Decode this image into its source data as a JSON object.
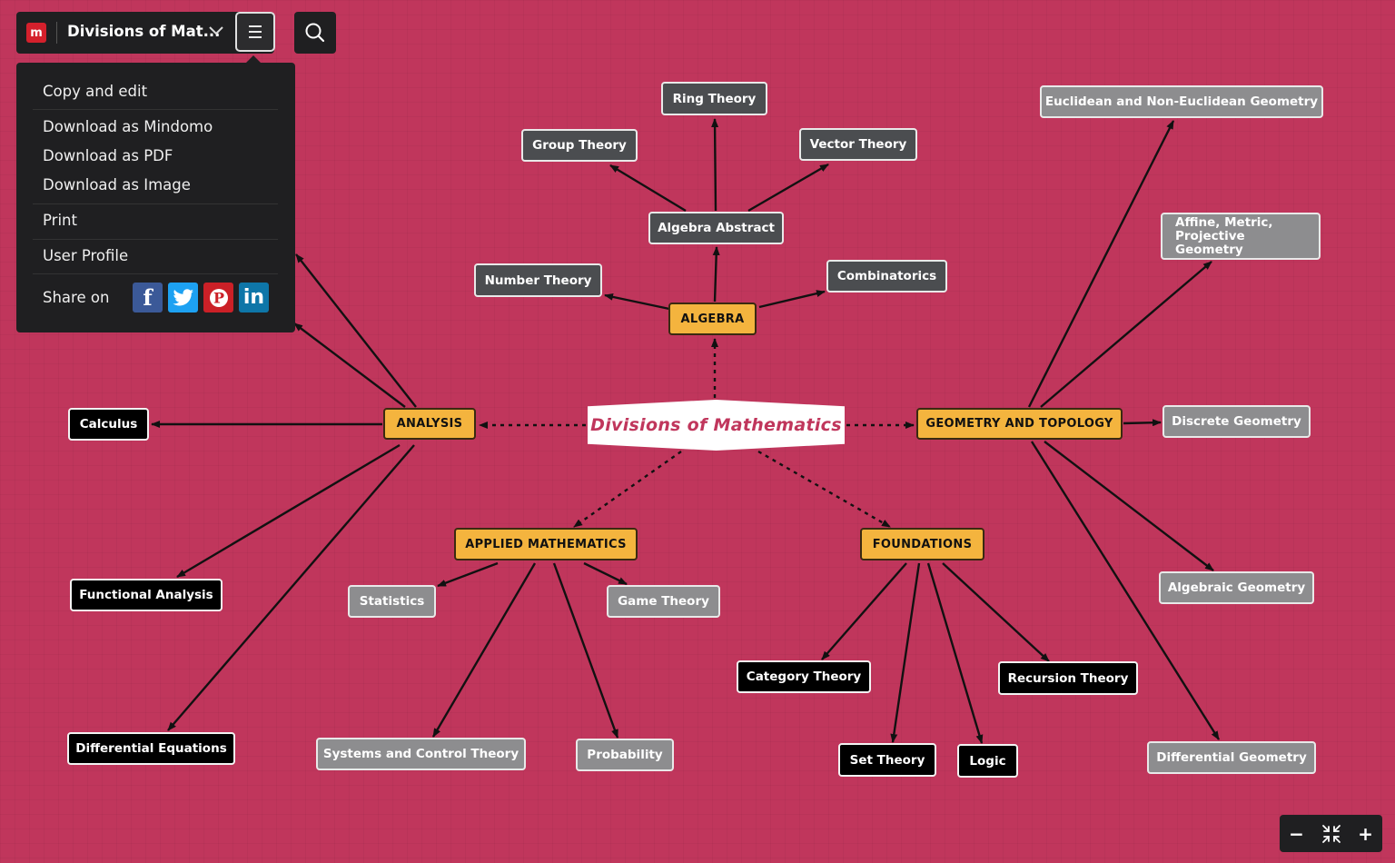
{
  "app": {
    "map_title": "Divisions of Mat...",
    "logo_text": "m"
  },
  "menu": {
    "items": [
      "Copy and edit",
      "Download as Mindomo",
      "Download as PDF",
      "Download as Image",
      "Print",
      "User Profile"
    ],
    "share_label": "Share on",
    "social": [
      {
        "name": "facebook",
        "glyph": "f",
        "color": "#3b5998"
      },
      {
        "name": "twitter",
        "glyph": "t",
        "color": "#1da1f2"
      },
      {
        "name": "pinterest",
        "glyph": "P",
        "color": "#cb2027"
      },
      {
        "name": "linkedin",
        "glyph": "in",
        "color": "#0e76a8"
      }
    ]
  },
  "mindmap": {
    "central": "Divisions of Mathematics",
    "branches": {
      "algebra": "ALGEBRA",
      "analysis": "ANALYSIS",
      "geometry": "GEOMETRY AND TOPOLOGY",
      "applied": "APPLIED MATHEMATICS",
      "foundations": "FOUNDATIONS"
    },
    "topics": {
      "ring_theory": "Ring Theory",
      "group_theory": "Group Theory",
      "vector_theory": "Vector Theory",
      "algebra_abstract": "Algebra Abstract",
      "number_theory": "Number Theory",
      "combinatorics": "Combinatorics",
      "calculus": "Calculus",
      "functional_analysis": "Functional Analysis",
      "differential_equations": "Differential Equations",
      "statistics": "Statistics",
      "game_theory": "Game Theory",
      "systems_control": "Systems and Control Theory",
      "probability": "Probability",
      "category_theory": "Category Theory",
      "recursion_theory": "Recursion Theory",
      "set_theory": "Set Theory",
      "logic": "Logic",
      "euclidean": "Euclidean and Non-Euclidean Geometry",
      "affine": "Affine, Metric, Projective Geometry",
      "discrete_geometry": "Discrete Geometry",
      "algebraic_geometry": "Algebraic Geometry",
      "differential_geometry": "Differential Geometry"
    }
  },
  "zoom": {
    "minus": "−",
    "plus": "+"
  },
  "colors": {
    "background": "#c0365c",
    "branch": "#f4b43e",
    "dark_node": "#4b4d50",
    "light_node": "#8d8d8f",
    "black_node": "#000000",
    "toolbar": "#1f1f21"
  }
}
